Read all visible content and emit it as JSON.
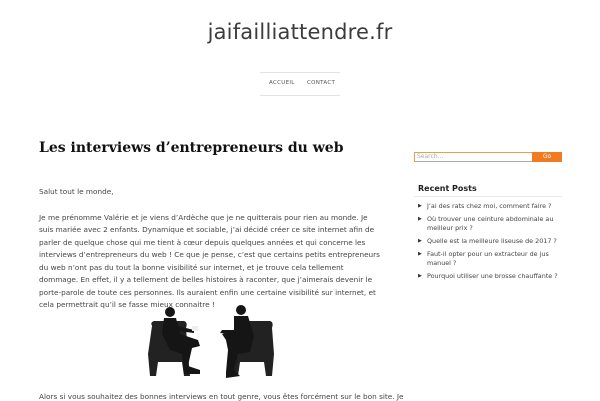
{
  "site": {
    "title": "jaifailliattendre.fr"
  },
  "nav": {
    "items": [
      "ACCUEIL",
      "CONTACT"
    ]
  },
  "post": {
    "title": "Les interviews d’entrepreneurs du web",
    "paragraphs": [
      "Salut tout le monde,",
      "Je me prénomme Valérie et je viens d’Ardèche que je ne quitterais pour rien au monde. Je suis mariée avec 2 enfants. Dynamique et sociable, j’ai décidé créer ce site internet afin de parler de quelque chose qui me tient à cœur depuis quelques années et qui concerne les interviews d’entrepreneurs du web ! Ce que je pense, c’est que certains petits entrepreneurs du web n’ont pas du tout la bonne visibilité sur internet, et je trouve cela tellement dommage. En effet, il y a tellement de belles histoires à raconter, que j’aimerais devenir le porte-parole de toute ces personnes. Ils auraient enfin une certaine visibilité sur internet, et cela permettrait qu’il se fasse mieux connaitre !"
    ],
    "closing": "Alors si vous souhaitez des bonnes interviews en tout genre, vous êtes forcément sur le bon site. Je"
  },
  "sidebar": {
    "search_placeholder": "Search...",
    "search_button": "Go",
    "recent_title": "Recent Posts",
    "recent_posts": [
      "J’ai des rats chez moi, comment faire ?",
      "Où trouver une ceinture abdominale au meilleur prix ?",
      "Quelle est la meilleure liseuse de 2017 ?",
      "Faut-il opter pour un extracteur de jus manuel ?",
      "Pourquoi utiliser une brosse chauffante ?"
    ]
  },
  "colors": {
    "accent": "#f07b22",
    "search_border": "#cfa277",
    "title": "#111111"
  },
  "icons": {
    "bullet": "triangle-right-icon"
  }
}
